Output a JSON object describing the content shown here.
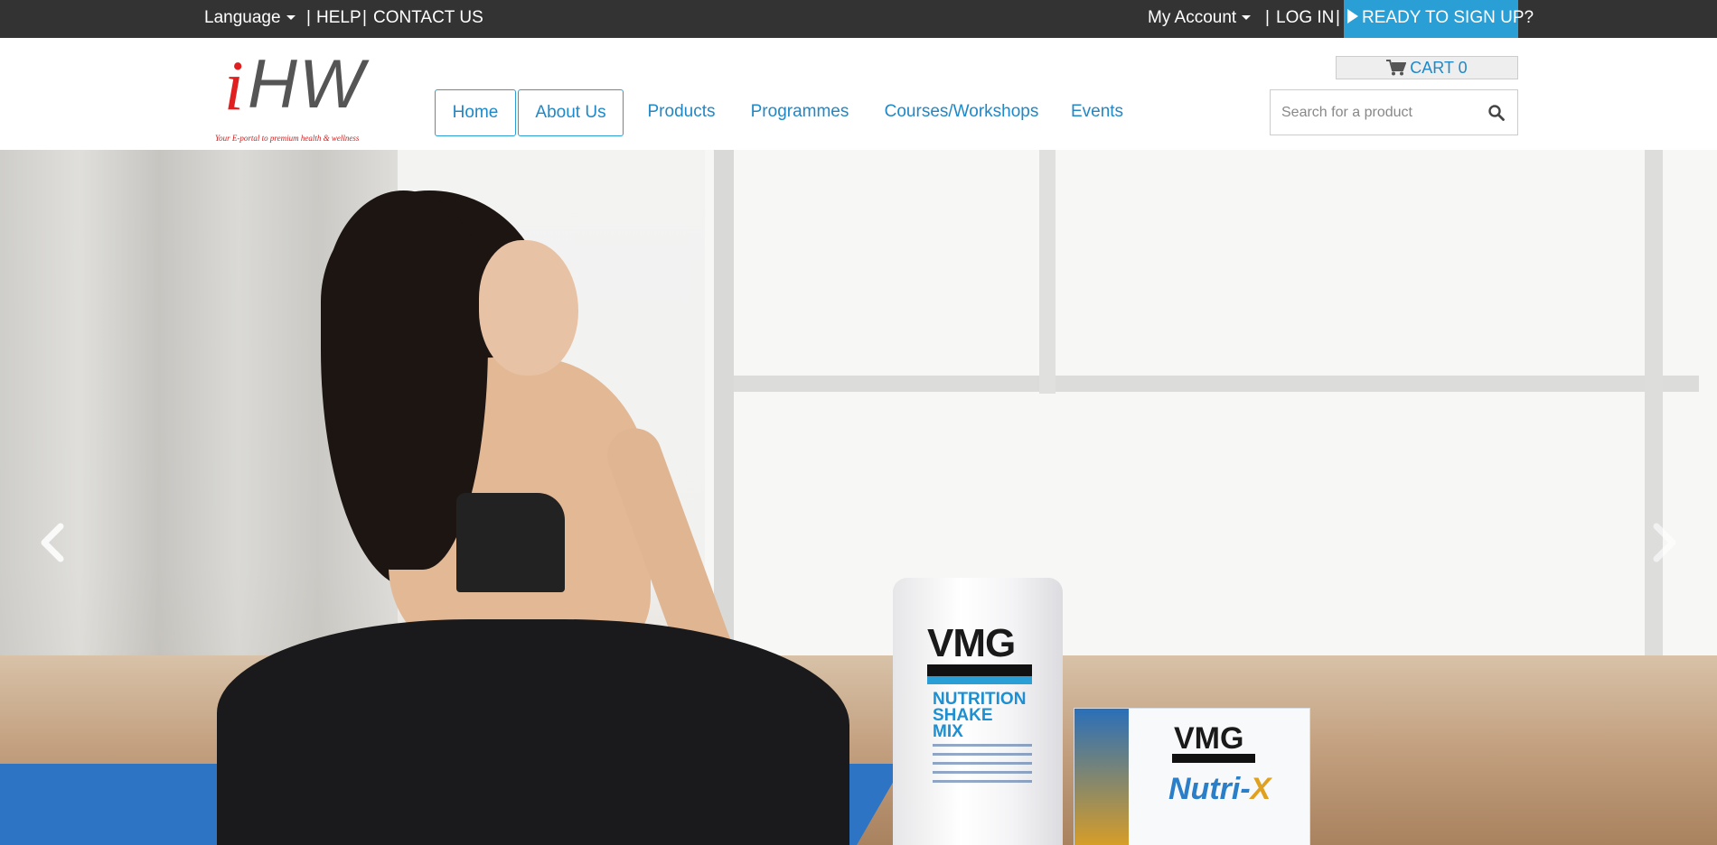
{
  "topbar": {
    "language": "Language",
    "sep1": "|",
    "help": "HELP",
    "sep2": "|",
    "contact": "CONTACT US",
    "my_account": "My Account",
    "sep3": "|",
    "login": "LOG IN",
    "sep4": "|",
    "signup": "READY TO SIGN UP?"
  },
  "logo": {
    "letter_i": "i",
    "letters_hw": "HW",
    "tagline": "Your E-portal to premium health & wellness"
  },
  "nav": {
    "items": [
      {
        "label": "Home",
        "boxed": true
      },
      {
        "label": "About Us",
        "boxed": true
      },
      {
        "label": "Products",
        "boxed": false
      },
      {
        "label": "Programmes",
        "boxed": false
      },
      {
        "label": "Courses/Workshops",
        "boxed": false
      },
      {
        "label": "Events",
        "boxed": false
      }
    ]
  },
  "cart": {
    "label": "CART",
    "count": "0",
    "icon": "shopping-cart-icon"
  },
  "search": {
    "placeholder": "Search for a product",
    "icon": "search-icon"
  },
  "hero": {
    "jar": {
      "brand": "VMG",
      "title_line1": "NUTRITION",
      "title_line2": "SHAKE",
      "title_line3": "MIX"
    },
    "box": {
      "brand": "VMG",
      "title": "Nutri-",
      "title_x": "X"
    },
    "prev_icon": "chevron-left-icon",
    "next_icon": "chevron-right-icon"
  },
  "colors": {
    "topbar_bg": "#333333",
    "accent": "#2a9fd6",
    "nav_text": "#1e88c8"
  }
}
